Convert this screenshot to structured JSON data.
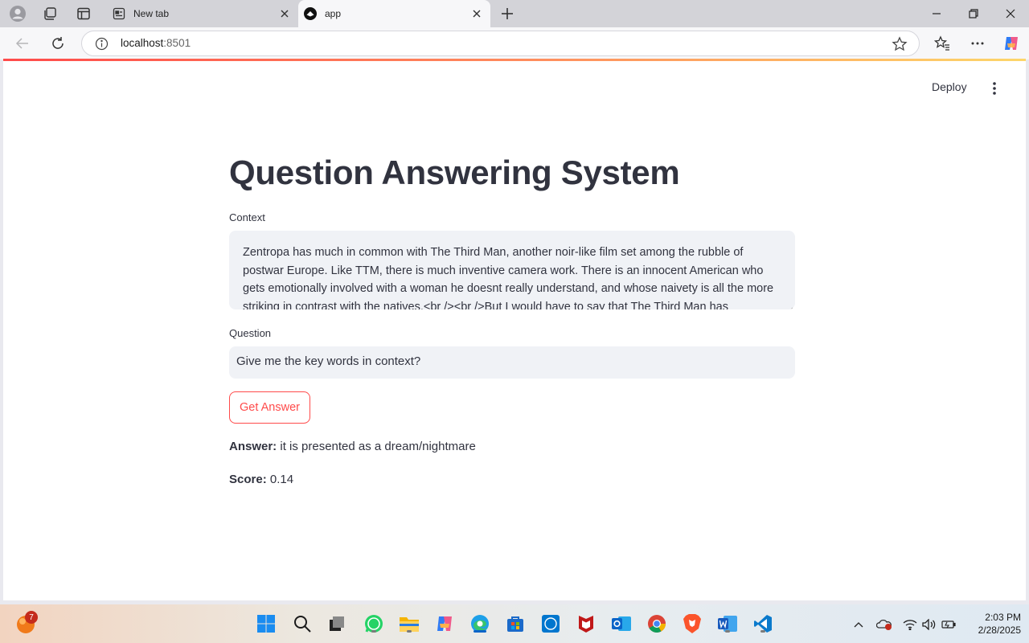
{
  "browser": {
    "tabs": [
      {
        "label": "New tab",
        "icon": "new-tab-page-icon",
        "active": false
      },
      {
        "label": "app",
        "icon": "streamlit-icon",
        "active": true
      }
    ],
    "url_host": "localhost",
    "url_port": ":8501"
  },
  "app": {
    "deploy_label": "Deploy",
    "title": "Question Answering System",
    "context_label": "Context",
    "context_text": "Zentropa has much in common with The Third Man, another noir-like film set among the rubble of postwar Europe. Like TTM, there is much inventive camera work. There is an innocent American who gets emotionally involved with a woman he doesnt really understand, and whose naivety is all the more striking in contrast with the natives.<br /><br />But I would have to say that The Third Man has",
    "question_label": "Question",
    "question_value": "Give me the key words in context?",
    "button_label": "Get Answer",
    "answer_label": "Answer:",
    "answer_value": "it is presented as a dream/nightmare",
    "score_label": "Score:",
    "score_value": "0.14",
    "accent_color": "#ff4b4b"
  },
  "taskbar": {
    "notification_count": "7",
    "apps": [
      "start-icon",
      "search-icon",
      "task-view-icon",
      "whatsapp-icon",
      "file-explorer-icon",
      "copilot-icon",
      "edge-icon",
      "store-icon",
      "dell-icon",
      "mcafee-icon",
      "outlook-icon",
      "chrome-icon",
      "brave-icon",
      "word-icon",
      "vscode-icon"
    ],
    "time": "2:03 PM",
    "date": "2/28/2025"
  }
}
